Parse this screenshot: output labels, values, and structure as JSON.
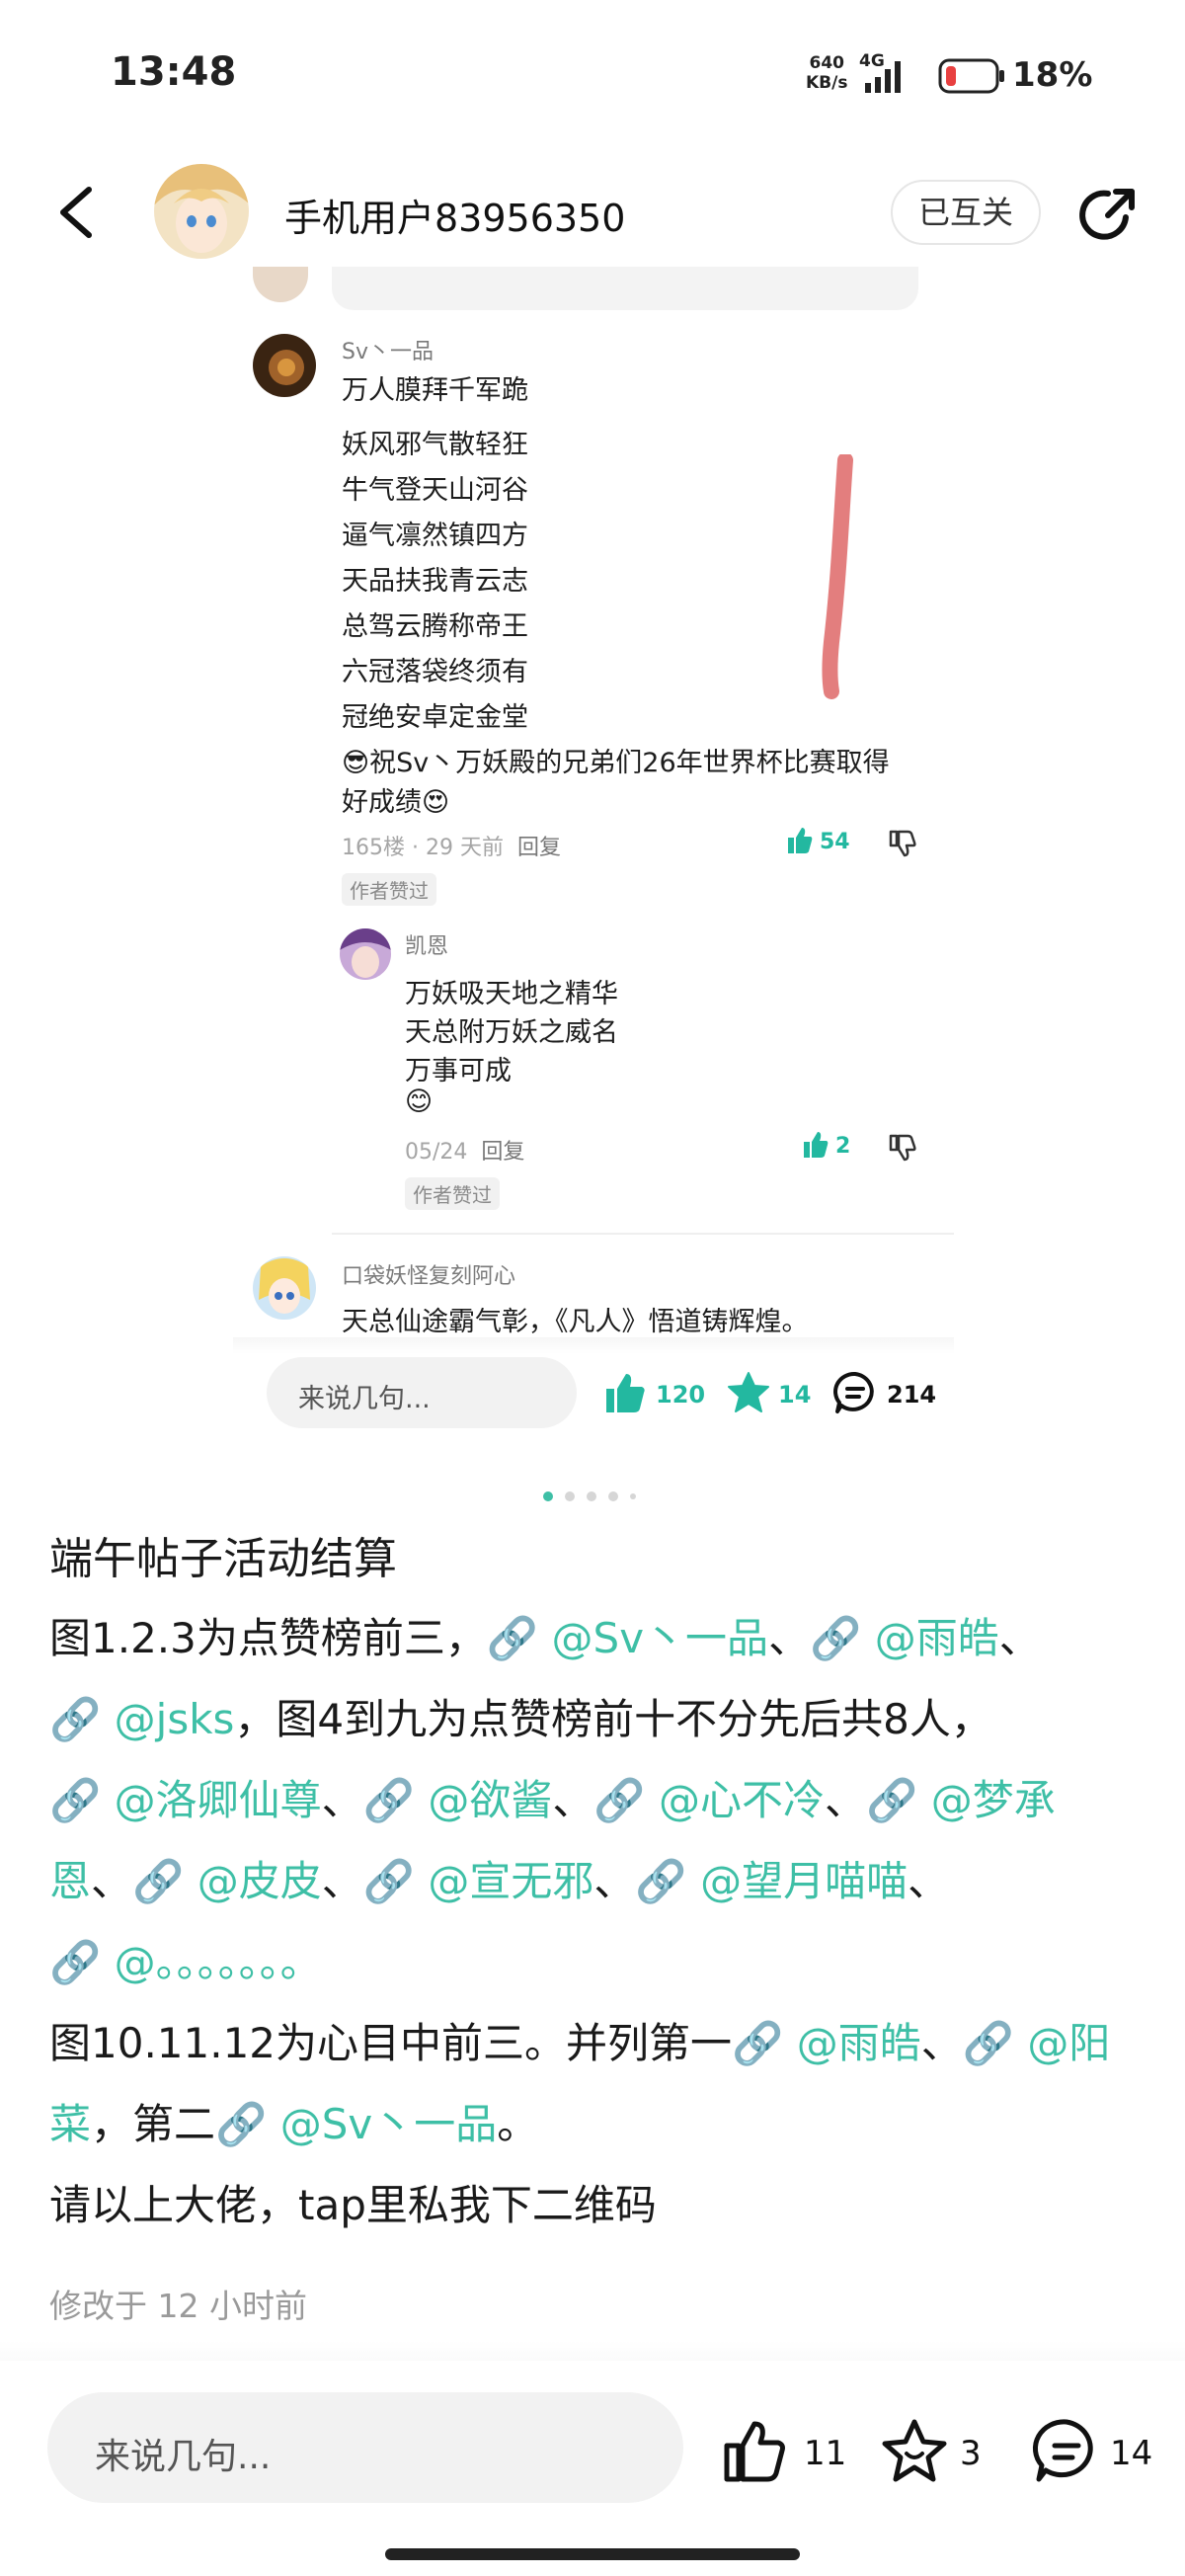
{
  "status_bar": {
    "time": "13:48",
    "net_speed_value": "640",
    "net_speed_unit": "KB/s",
    "network": "4G",
    "battery": "18%"
  },
  "header": {
    "user_name": "手机用户83956350",
    "follow_state": "已互关"
  },
  "embedded_screenshot": {
    "comments": [
      {
        "author": "Sv丶一品",
        "lines": [
          "万人膜拜千军跪",
          "妖风邪气散轻狂",
          "牛气登天山河谷",
          "逼气凛然镇四方",
          "天品扶我青云志",
          "总驾云腾称帝王",
          "六冠落袋终须有",
          "冠绝安卓定金堂",
          "😎祝Sv丶万妖殿的兄弟们26年世界杯比赛取得",
          "好成绩😍"
        ],
        "meta": "165楼 · 29 天前",
        "reply": "回复",
        "likes": "54",
        "badge": "作者赞过"
      },
      {
        "author": "凯恩",
        "lines": [
          "万妖吸天地之精华",
          "天总附万妖之威名",
          "万事可成",
          "😊"
        ],
        "meta": "05/24",
        "reply": "回复",
        "likes": "2",
        "badge": "作者赞过"
      },
      {
        "author": "口袋妖怪复刻阿心",
        "lines": [
          "天总仙途霸气彰，《凡人》悟道铸辉煌。"
        ]
      }
    ],
    "input_placeholder": "来说几句...",
    "likes": "120",
    "favorites": "14",
    "comments_count": "214"
  },
  "post": {
    "title": "端午帖子活动结算",
    "p1_a": "图1.2.3为点赞榜前三，",
    "m1": "@Sv丶一品",
    "sep": "、",
    "m2": "@雨皓",
    "m3": "@jsks",
    "p1_b": "，图4到九为点赞榜前十不分先后共8人，",
    "m4": "@洛卿仙尊",
    "m5": "@欲酱",
    "m6": "@心不冷",
    "m7": "@梦承",
    "m7b": "恩",
    "m8": "@皮皮",
    "m9": "@宣无邪",
    "m10": "@望月喵喵",
    "m11": "@。。。。。。。",
    "p2_a": "图10.11.12为心目中前三。并列第一",
    "m12": "@雨皓",
    "m13": "@阳",
    "m13b": "菜",
    "p2_b": "，第二",
    "m14": "@Sv丶一品",
    "period": "。",
    "p3": "请以上大佬，tap里私我下二维码",
    "edited": "修改于 12 小时前"
  },
  "bottom_bar": {
    "input_placeholder": "来说几句...",
    "likes": "11",
    "favorites": "3",
    "comments": "14"
  }
}
